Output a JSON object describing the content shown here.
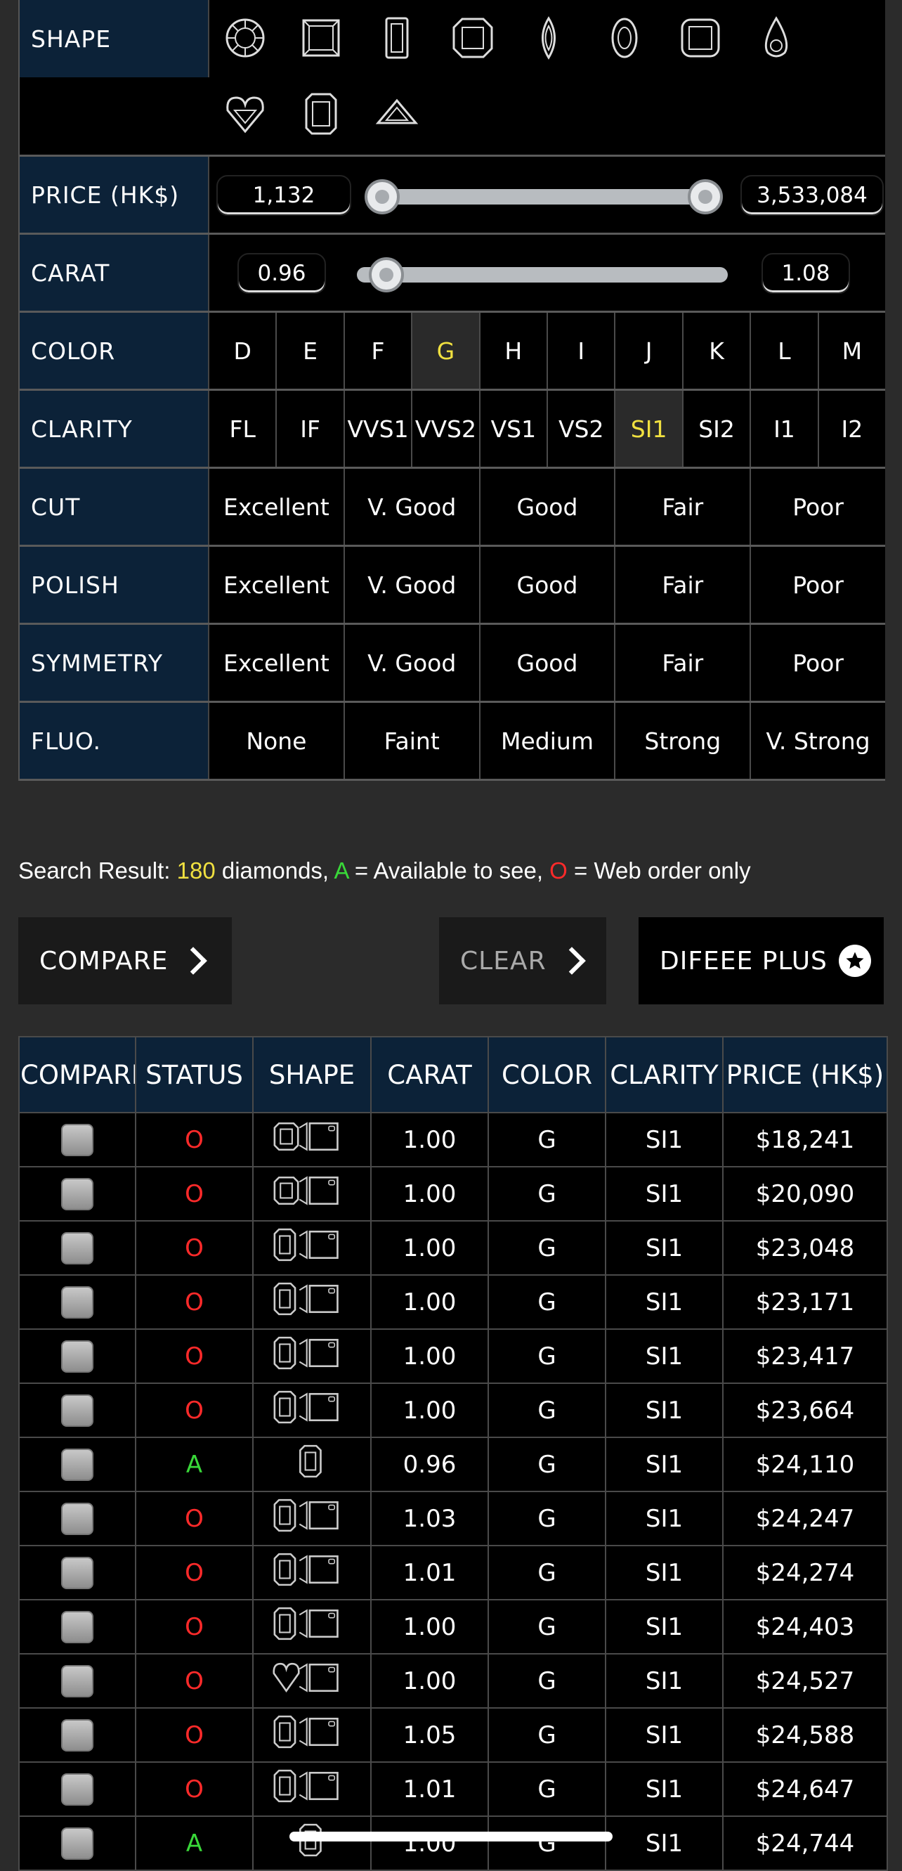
{
  "filters": {
    "shape_label": "SHAPE",
    "shape_icons": [
      "round-icon",
      "princess-icon",
      "emerald-icon",
      "asscher-icon",
      "marquise-icon",
      "oval-icon",
      "cushion-icon",
      "pear-icon",
      "heart-icon",
      "radiant-icon",
      "trillion-icon"
    ],
    "price_label": "PRICE (HK$)",
    "price_min": "1,132",
    "price_max": "3,533,084",
    "price_range": {
      "low": 0.0,
      "high": 1.0
    },
    "carat_label": "CARAT",
    "carat_min": "0.96",
    "carat_max": "1.08",
    "carat_range": {
      "low": 0.08,
      "high": 0.9
    },
    "color_label": "COLOR",
    "colors": [
      "D",
      "E",
      "F",
      "G",
      "H",
      "I",
      "J",
      "K",
      "L",
      "M"
    ],
    "color_selected": "G",
    "clarity_label": "CLARITY",
    "clarities": [
      "FL",
      "IF",
      "VVS1",
      "VVS2",
      "VS1",
      "VS2",
      "SI1",
      "SI2",
      "I1",
      "I2"
    ],
    "clarity_selected": "SI1",
    "cut_label": "CUT",
    "polish_label": "POLISH",
    "symmetry_label": "SYMMETRY",
    "grades": [
      "Excellent",
      "V. Good",
      "Good",
      "Fair",
      "Poor"
    ],
    "fluo_label": "FLUO.",
    "fluo": [
      "None",
      "Faint",
      "Medium",
      "Strong",
      "V. Strong"
    ]
  },
  "summary": {
    "prefix": "Search Result: ",
    "count": "180",
    "mid": " diamonds, ",
    "a": "A",
    "a_text": " = Available to see, ",
    "o": "O",
    "o_text": " = Web order only"
  },
  "buttons": {
    "compare": "COMPARE",
    "clear": "CLEAR",
    "plus": "DIFEEE PLUS"
  },
  "table": {
    "headers": [
      "COMPARE",
      "STATUS",
      "SHAPE",
      "CARAT",
      "COLOR",
      "CLARITY",
      "PRICE (HK$)"
    ],
    "rows": [
      {
        "status": "O",
        "shape": "asscher",
        "carat": "1.00",
        "color": "G",
        "clarity": "SI1",
        "price": "$18,241"
      },
      {
        "status": "O",
        "shape": "asscher",
        "carat": "1.00",
        "color": "G",
        "clarity": "SI1",
        "price": "$20,090"
      },
      {
        "status": "O",
        "shape": "radiant",
        "carat": "1.00",
        "color": "G",
        "clarity": "SI1",
        "price": "$23,048"
      },
      {
        "status": "O",
        "shape": "radiant",
        "carat": "1.00",
        "color": "G",
        "clarity": "SI1",
        "price": "$23,171"
      },
      {
        "status": "O",
        "shape": "radiant",
        "carat": "1.00",
        "color": "G",
        "clarity": "SI1",
        "price": "$23,417"
      },
      {
        "status": "O",
        "shape": "radiant",
        "carat": "1.00",
        "color": "G",
        "clarity": "SI1",
        "price": "$23,664"
      },
      {
        "status": "A",
        "shape": "radiant",
        "carat": "0.96",
        "color": "G",
        "clarity": "SI1",
        "price": "$24,110"
      },
      {
        "status": "O",
        "shape": "radiant",
        "carat": "1.03",
        "color": "G",
        "clarity": "SI1",
        "price": "$24,247"
      },
      {
        "status": "O",
        "shape": "radiant",
        "carat": "1.01",
        "color": "G",
        "clarity": "SI1",
        "price": "$24,274"
      },
      {
        "status": "O",
        "shape": "radiant",
        "carat": "1.00",
        "color": "G",
        "clarity": "SI1",
        "price": "$24,403"
      },
      {
        "status": "O",
        "shape": "heart",
        "carat": "1.00",
        "color": "G",
        "clarity": "SI1",
        "price": "$24,527"
      },
      {
        "status": "O",
        "shape": "radiant",
        "carat": "1.05",
        "color": "G",
        "clarity": "SI1",
        "price": "$24,588"
      },
      {
        "status": "O",
        "shape": "radiant",
        "carat": "1.01",
        "color": "G",
        "clarity": "SI1",
        "price": "$24,647"
      },
      {
        "status": "A",
        "shape": "radiant",
        "carat": "1.00",
        "color": "G",
        "clarity": "SI1",
        "price": "$24,744"
      }
    ]
  }
}
